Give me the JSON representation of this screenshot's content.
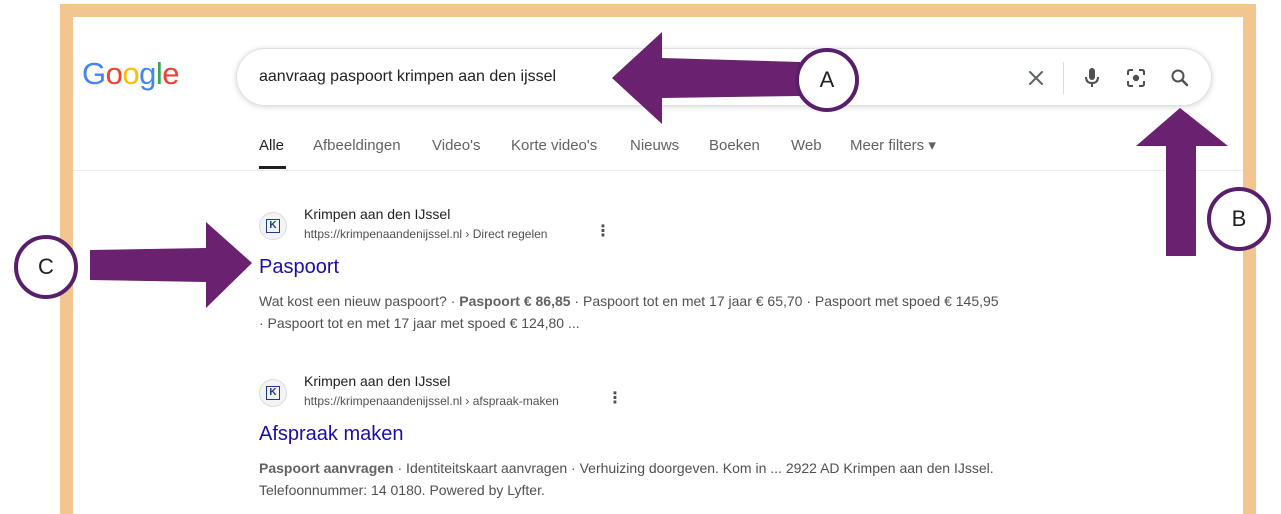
{
  "logo": {
    "letters": [
      "G",
      "o",
      "o",
      "g",
      "l",
      "e"
    ],
    "colors": [
      "#4285F4",
      "#EA4335",
      "#FBBC05",
      "#4285F4",
      "#34A853",
      "#EA4335"
    ]
  },
  "search": {
    "query": "aanvraag paspoort krimpen aan den ijssel"
  },
  "tabs": [
    "Alle",
    "Afbeeldingen",
    "Video's",
    "Korte video's",
    "Nieuws",
    "Boeken",
    "Web",
    "Meer filters ▾"
  ],
  "results": [
    {
      "favicon_letter": "K",
      "site_name": "Krimpen aan den IJssel",
      "url": "https://krimpenaandenijssel.nl › Direct regelen",
      "title": "Paspoort",
      "snippet_pre": "Wat kost een nieuw paspoort? · ",
      "snippet_bold": "Paspoort € 86,85",
      "snippet_post": " · Paspoort tot en met 17 jaar € 65,70 · Paspoort met spoed € 145,95 · Paspoort tot en met 17 jaar met spoed € 124,80 ..."
    },
    {
      "favicon_letter": "K",
      "site_name": "Krimpen aan den IJssel",
      "url": "https://krimpenaandenijssel.nl › afspraak-maken",
      "title": "Afspraak maken",
      "snippet_pre": "",
      "snippet_bold": "Paspoort aanvragen",
      "snippet_post": " · Identiteitskaart aanvragen · Verhuizing doorgeven. Kom in ... 2922 AD Krimpen aan den IJssel. Telefoonnummer: 14 0180. Powered by Lyfter."
    }
  ],
  "annotations": {
    "a": "A",
    "b": "B",
    "c": "C"
  },
  "colors": {
    "frame": "#f2c68e",
    "arrow": "#6a2170",
    "circle_border": "#5a1f6b",
    "link": "#1a0dab"
  }
}
